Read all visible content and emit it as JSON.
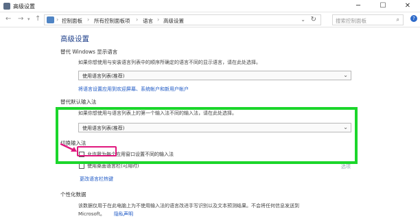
{
  "window": {
    "title": "高级设置",
    "minimize": "─",
    "maximize": "☐",
    "close": "✕"
  },
  "nav": {
    "back": "←",
    "forward": "→",
    "up": "↑",
    "breadcrumbs": [
      "控制面板",
      "所有控制面板项",
      "语言",
      "高级设置"
    ],
    "search_placeholder": "搜索控制面板",
    "help": "?"
  },
  "page": {
    "title": "高级设置",
    "display_lang": {
      "heading": "替代 Windows 显示语言",
      "description": "如果你想使用与安装语言列表中的顺序所确定的语言不同的显示语言，请在此处选择。",
      "select_value": "使用语言列表(推荐)",
      "link": "将语言设置应用到欢迎屏幕、系统帐户和新用户帐户"
    },
    "input_method": {
      "heading": "替代默认输入法",
      "description": "如果你想使用与语言列表上的第一个输入法不同的输入法，请在此处选择。",
      "select_value": "使用语言列表(推荐)"
    },
    "switch": {
      "heading": "切换输入法",
      "checkbox1": "允许我为每个应用窗口设置不同的输入法",
      "checkbox2": "使用桌面语言栏(可用时)",
      "options_link": "选项",
      "hotkey_link": "更改语言栏热键"
    },
    "personal": {
      "heading": "个性化数据",
      "description_line1": "该数据仅用于在此电脑上为不使用输入法的语言改进手写识别以及文本预测结果。不会将任何信息发送到",
      "description_line2_prefix": "Microsoft。",
      "privacy_link": "隐私声明"
    }
  },
  "colors": {
    "highlight": "#1bd62b",
    "emphasis": "#e0177d",
    "link": "#1a56c4",
    "title": "#1e3f8a"
  }
}
